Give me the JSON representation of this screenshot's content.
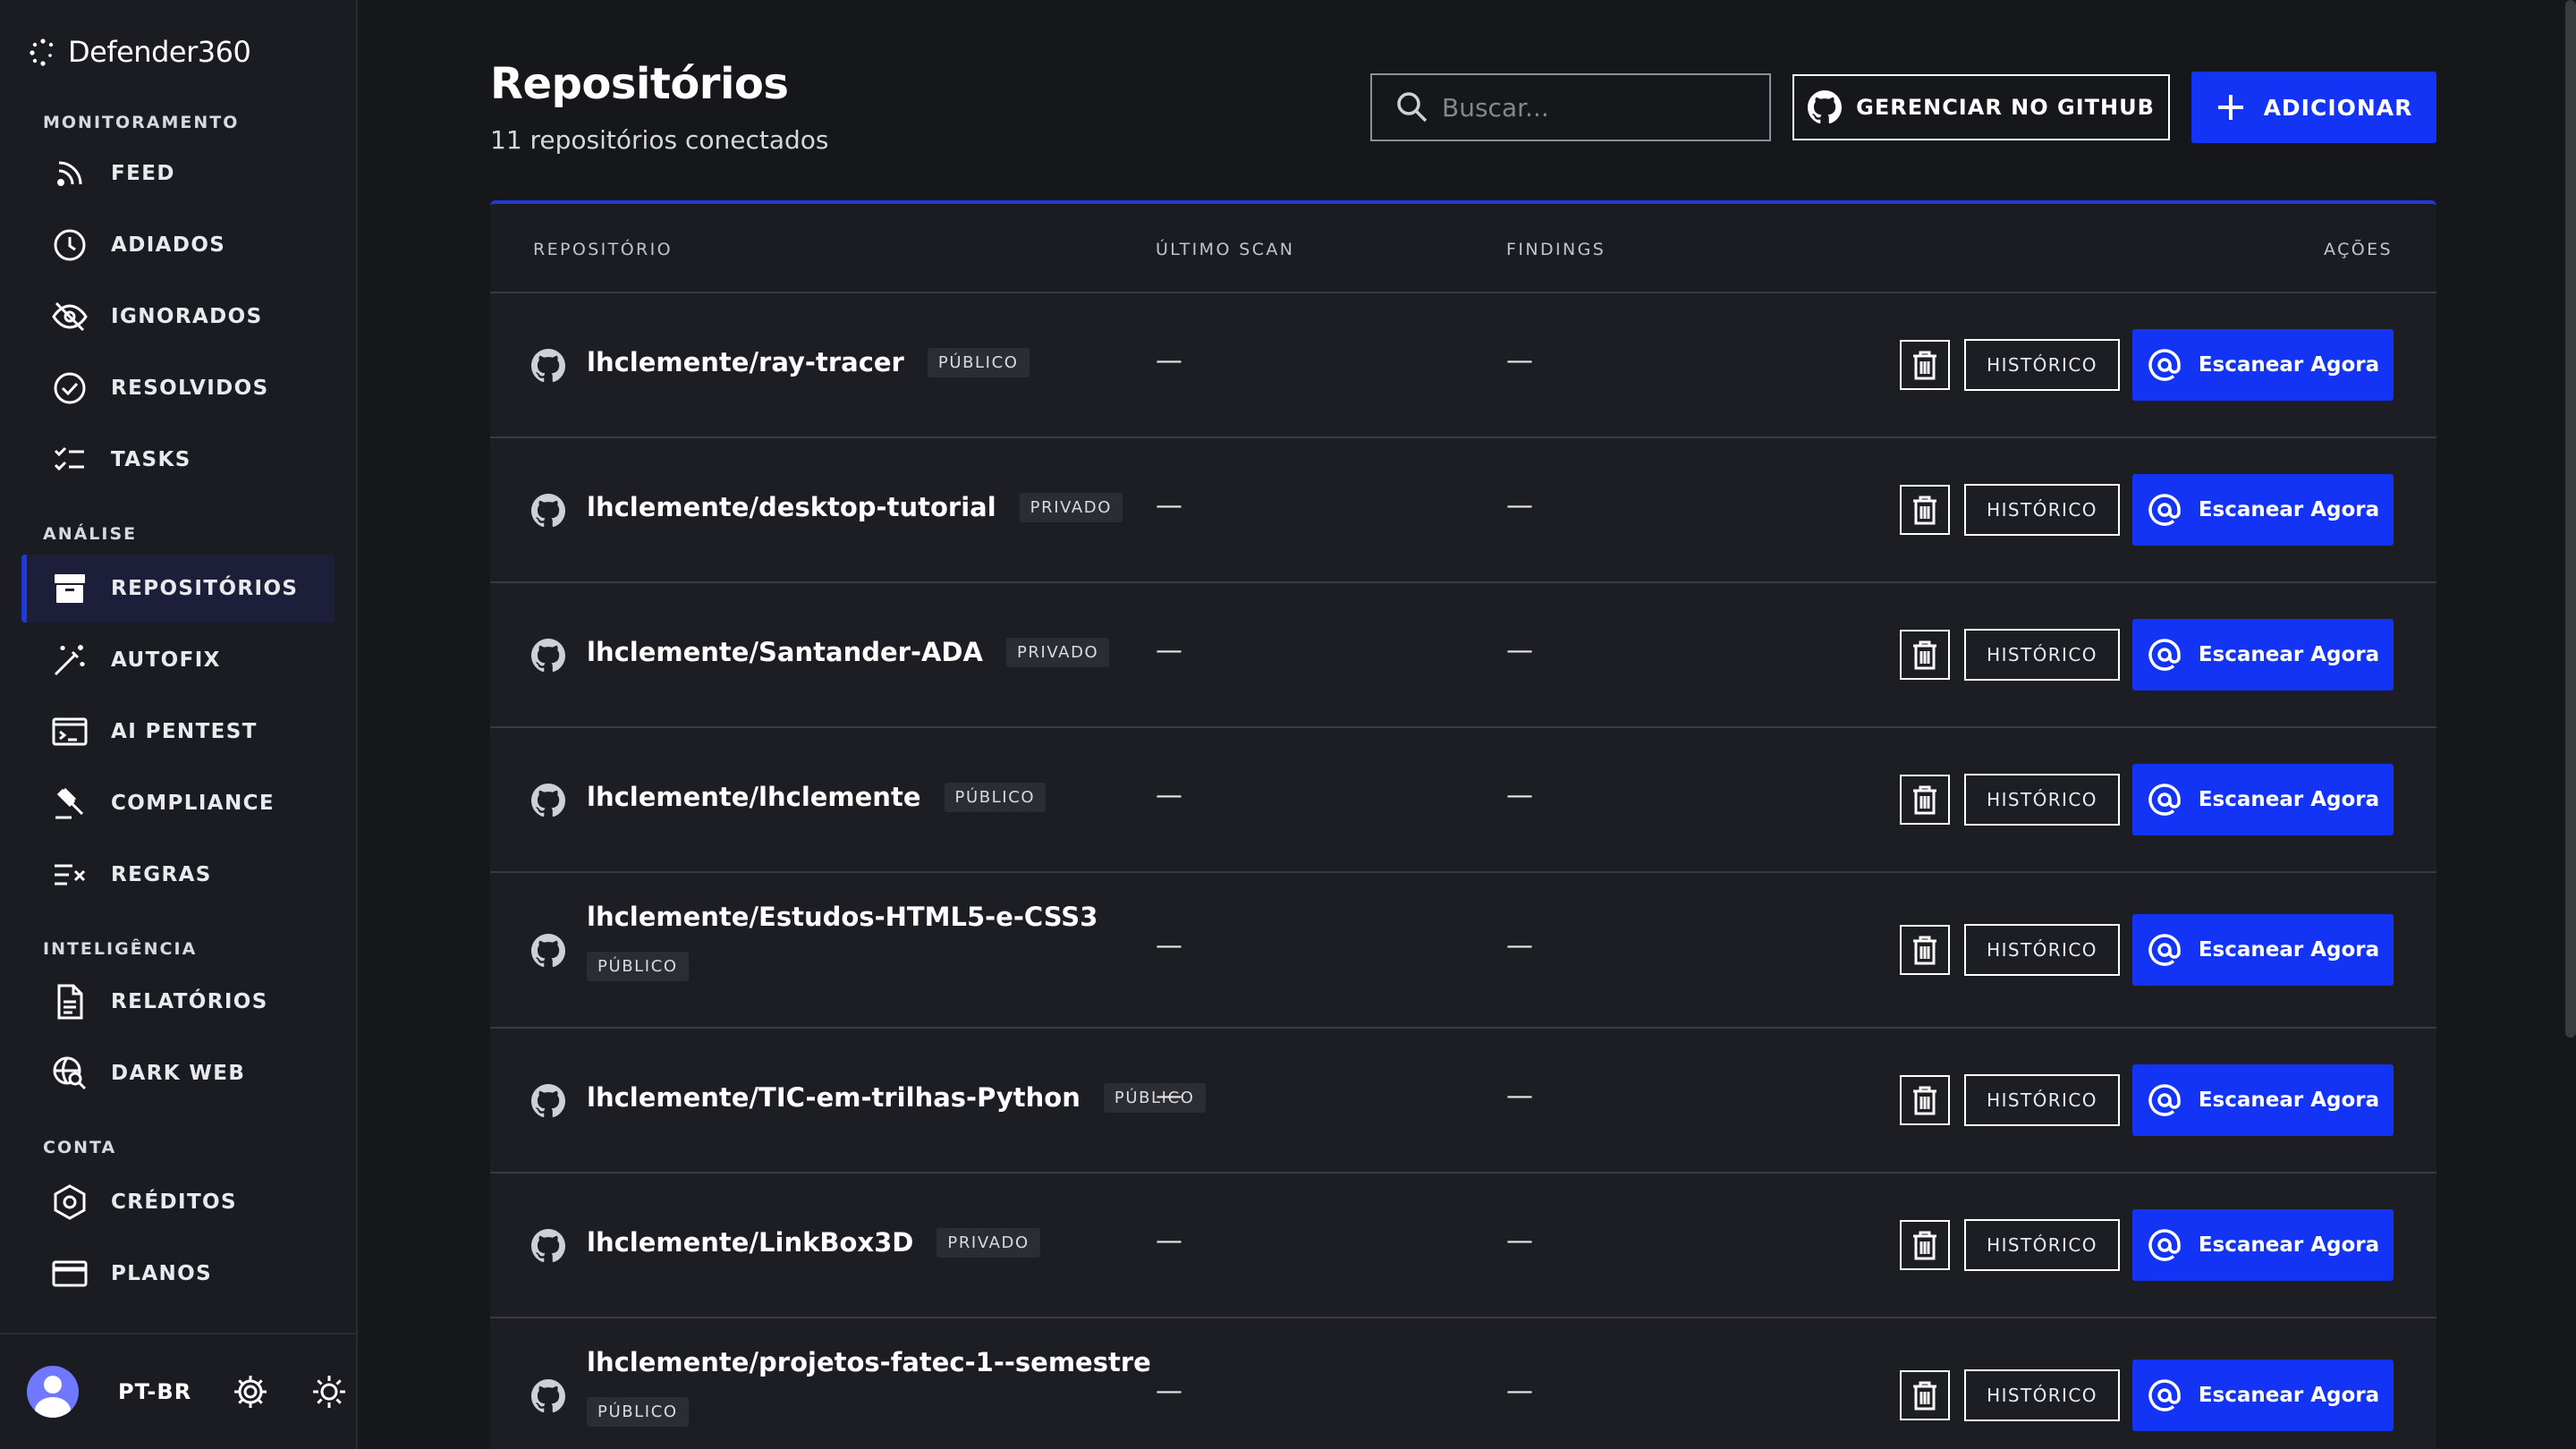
{
  "brand": {
    "name": "Defender360"
  },
  "sidebar": {
    "sections": [
      {
        "title": "MONITORAMENTO",
        "items": [
          {
            "label": "FEED",
            "icon": "rss-icon"
          },
          {
            "label": "ADIADOS",
            "icon": "clock-icon"
          },
          {
            "label": "IGNORADOS",
            "icon": "eye-off-icon"
          },
          {
            "label": "RESOLVIDOS",
            "icon": "check-circle-icon"
          },
          {
            "label": "TASKS",
            "icon": "checklist-icon"
          }
        ]
      },
      {
        "title": "ANÁLISE",
        "items": [
          {
            "label": "REPOSITÓRIOS",
            "icon": "archive-icon",
            "active": true
          },
          {
            "label": "AUTOFIX",
            "icon": "magic-wand-icon"
          },
          {
            "label": "AI PENTEST",
            "icon": "terminal-icon"
          },
          {
            "label": "COMPLIANCE",
            "icon": "gavel-icon"
          },
          {
            "label": "REGRAS",
            "icon": "rules-icon"
          }
        ]
      },
      {
        "title": "INTELIGÊNCIA",
        "items": [
          {
            "label": "RELATÓRIOS",
            "icon": "document-icon"
          },
          {
            "label": "DARK WEB",
            "icon": "globe-search-icon"
          }
        ]
      },
      {
        "title": "CONTA",
        "items": [
          {
            "label": "CRÉDITOS",
            "icon": "hexagon-icon"
          },
          {
            "label": "PLANOS",
            "icon": "credit-card-icon"
          }
        ]
      }
    ],
    "footer": {
      "language": "PT-BR"
    }
  },
  "header": {
    "title": "Repositórios",
    "subtitle": "11 repositórios conectados",
    "search_placeholder": "Buscar...",
    "github_button": "GERENCIAR NO GITHUB",
    "add_button": "ADICIONAR"
  },
  "table": {
    "columns": [
      "REPOSITÓRIO",
      "ÚLTIMO SCAN",
      "FINDINGS",
      "AÇÕES"
    ],
    "history_label": "HISTÓRICO",
    "scan_label": "Escanear Agora",
    "rows": [
      {
        "name": "lhclemente/ray-tracer",
        "visibility": "PÚBLICO",
        "last_scan": "—",
        "findings": "—"
      },
      {
        "name": "lhclemente/desktop-tutorial",
        "visibility": "PRIVADO",
        "last_scan": "—",
        "findings": "—"
      },
      {
        "name": "lhclemente/Santander-ADA",
        "visibility": "PRIVADO",
        "last_scan": "—",
        "findings": "—"
      },
      {
        "name": "lhclemente/lhclemente",
        "visibility": "PÚBLICO",
        "last_scan": "—",
        "findings": "—"
      },
      {
        "name": "lhclemente/Estudos-HTML5-e-CSS3",
        "visibility": "PÚBLICO",
        "last_scan": "—",
        "findings": "—"
      },
      {
        "name": "lhclemente/TIC-em-trilhas-Python",
        "visibility": "PÚBLICO",
        "last_scan": "—",
        "findings": "—"
      },
      {
        "name": "lhclemente/LinkBox3D",
        "visibility": "PRIVADO",
        "last_scan": "—",
        "findings": "—"
      },
      {
        "name": "lhclemente/projetos-fatec-1--semestre",
        "visibility": "PÚBLICO",
        "last_scan": "—",
        "findings": "—"
      }
    ]
  },
  "colors": {
    "background": "#16171b",
    "sidebar": "#1b1c21",
    "row": "#1d1e23",
    "accent": "#1434f5",
    "badge": "#2c2d33"
  }
}
